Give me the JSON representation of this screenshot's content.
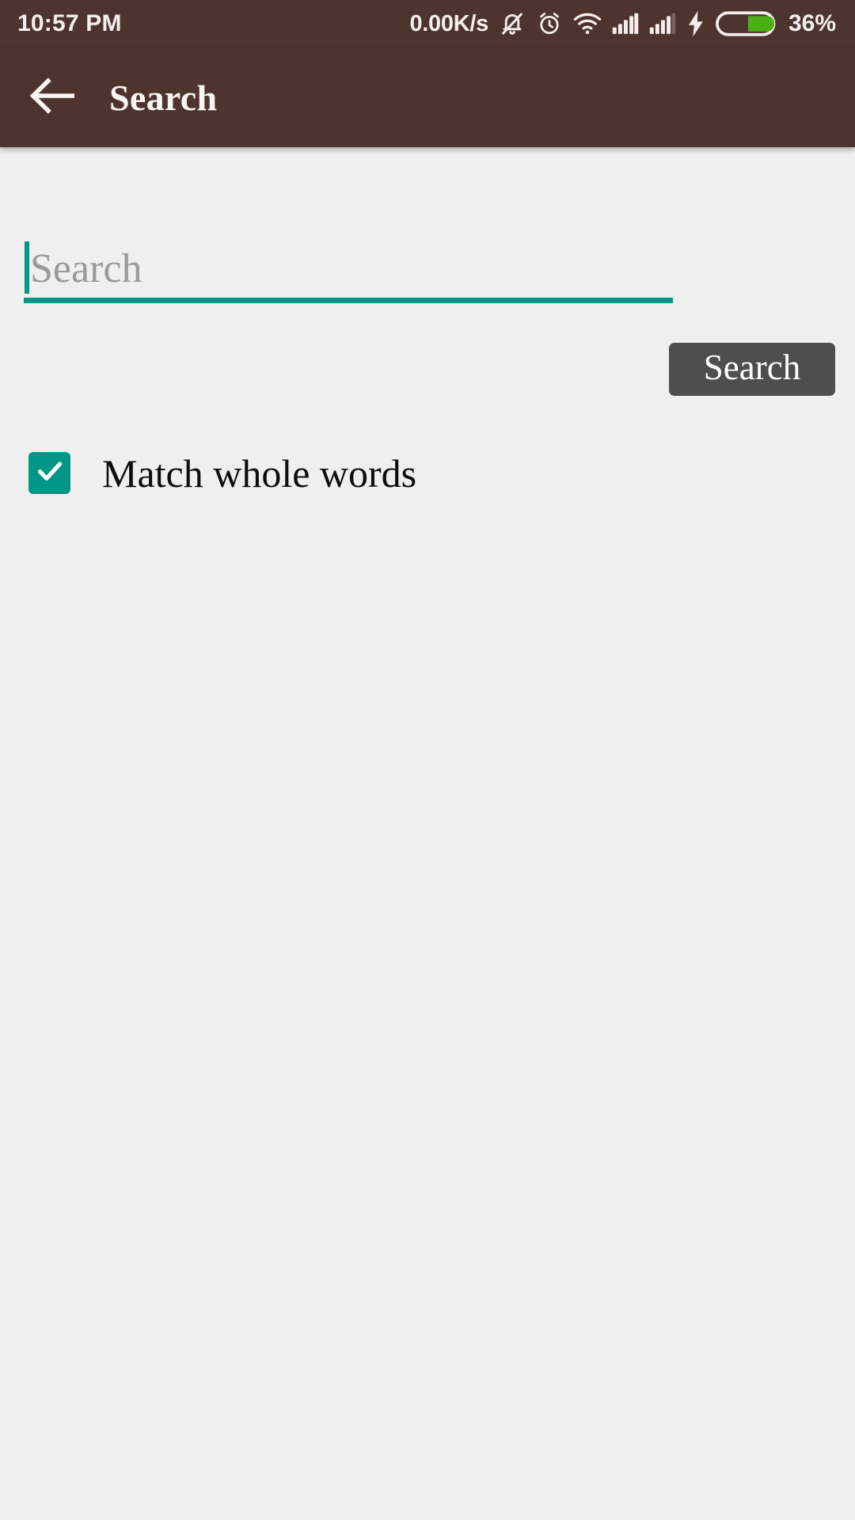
{
  "statusbar": {
    "time": "10:57 PM",
    "network_speed": "0.00K/s",
    "icons": [
      {
        "name": "bell-muted-icon"
      },
      {
        "name": "alarm-clock-icon"
      },
      {
        "name": "wifi-icon"
      },
      {
        "name": "signal-sim1-icon"
      },
      {
        "name": "signal-sim2-icon"
      },
      {
        "name": "charging-bolt-icon"
      },
      {
        "name": "battery-icon"
      }
    ],
    "battery_percent": "36%",
    "battery_level": 36,
    "battery_fill_color": "#4caf15",
    "background_color": "#4E342E",
    "text_color": "#f4efec"
  },
  "appbar": {
    "back_icon": "arrow-left-icon",
    "title": "Search",
    "background_color": "#4E342E",
    "title_color": "#fbf6f3"
  },
  "main": {
    "background_color": "#efefef",
    "search_field": {
      "value": "",
      "placeholder": "Search",
      "caret_color": "#009688",
      "underline_color": "#009688"
    },
    "search_button": {
      "label": "Search",
      "background_color": "#4e4e4e",
      "text_color": "#ffffff"
    },
    "match_whole_words": {
      "label": "Match whole words",
      "checked": true,
      "check_color": "#009688",
      "checkmark_icon": "checkmark-icon"
    }
  }
}
